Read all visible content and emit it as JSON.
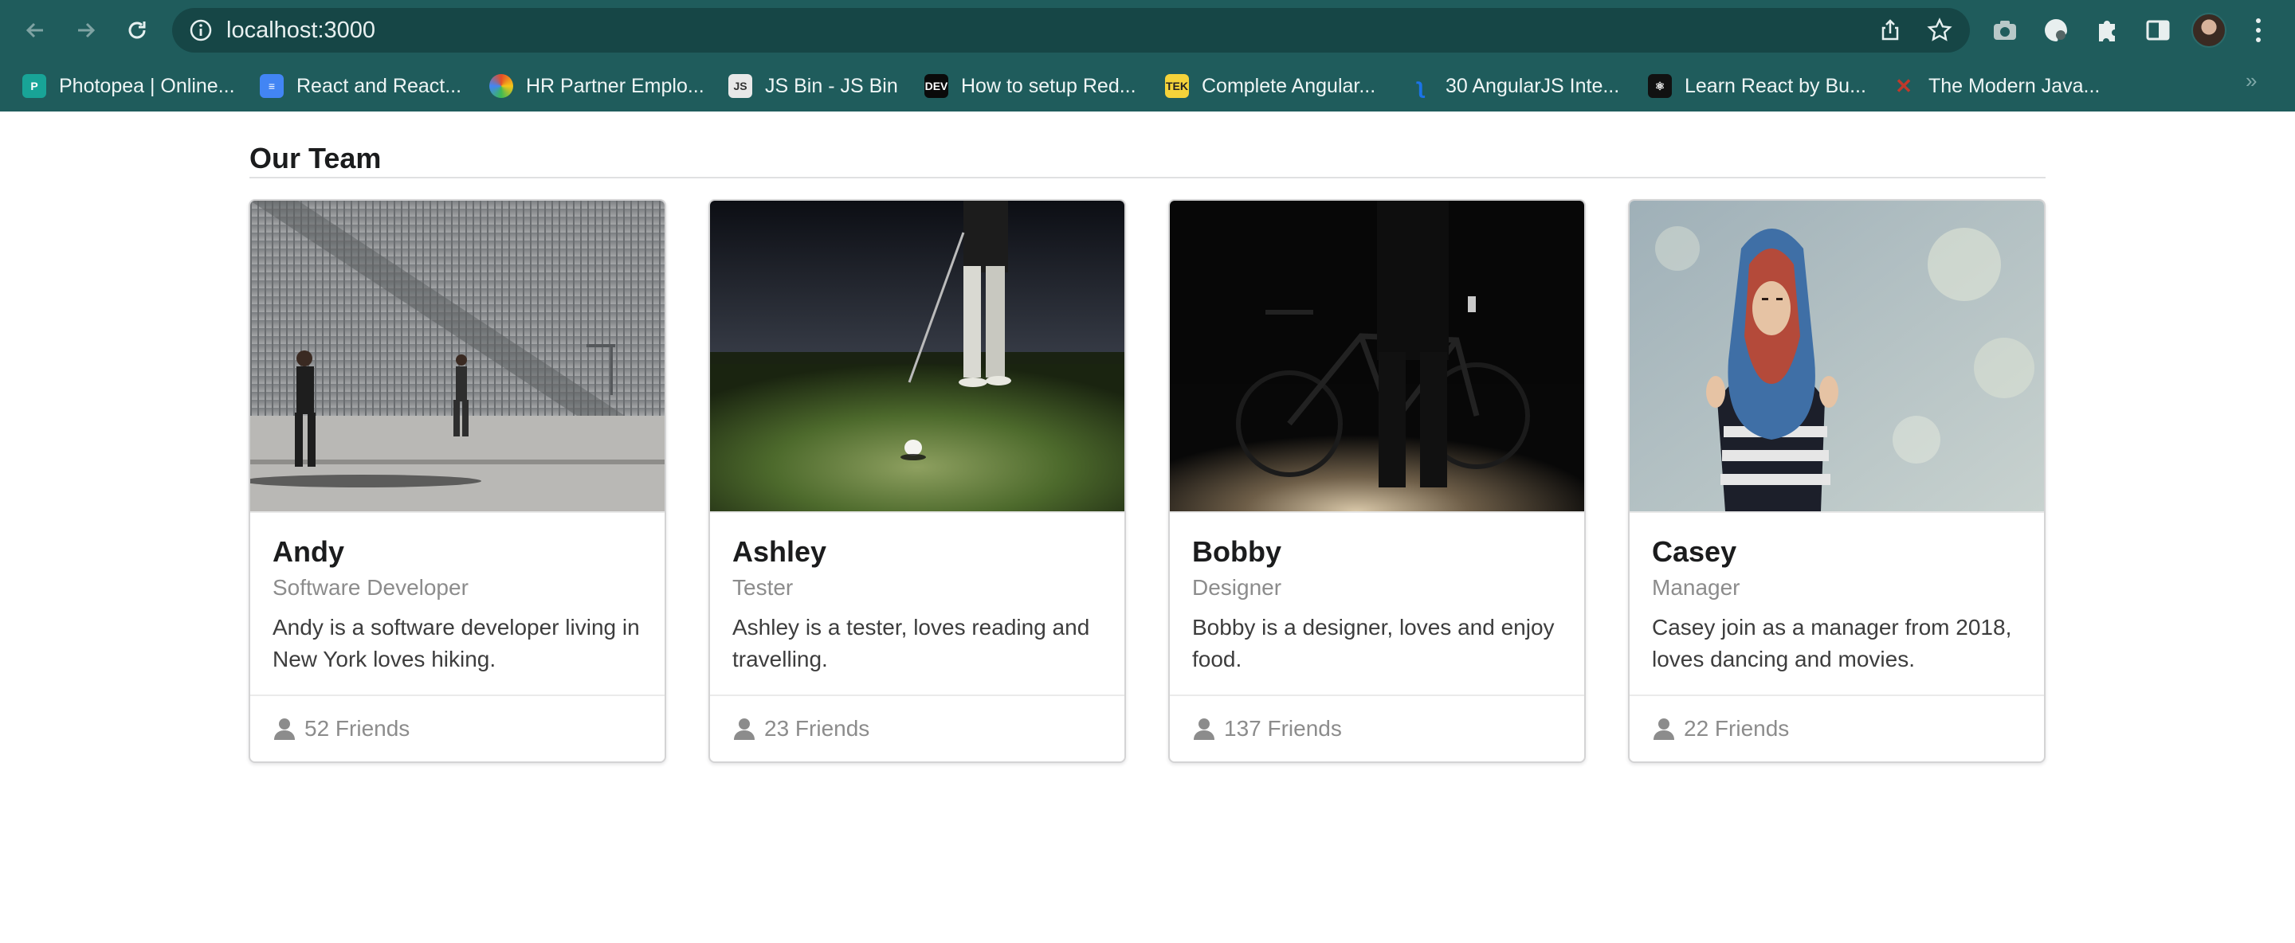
{
  "browser": {
    "url": "localhost:3000",
    "bookmarks": [
      {
        "label": "Photopea | Online...",
        "icon": "photopea-icon",
        "color": "#18a497"
      },
      {
        "label": "React and React...",
        "icon": "docs-icon",
        "color": "#4285f4"
      },
      {
        "label": "HR Partner Emplo...",
        "icon": "hr-partner-icon",
        "color": "#e44d26"
      },
      {
        "label": "JS Bin - JS Bin",
        "icon": "jsbin-icon",
        "color": "#e8e8e8"
      },
      {
        "label": "How to setup Red...",
        "icon": "dev-icon",
        "color": "#0a0a0a"
      },
      {
        "label": "Complete Angular...",
        "icon": "tek-icon",
        "color": "#f5d33a"
      },
      {
        "label": "30 AngularJS Inte...",
        "icon": "angular-icon",
        "color": "#1a73e8"
      },
      {
        "label": "Learn React by Bu...",
        "icon": "react-icon",
        "color": "#111111"
      },
      {
        "label": "The Modern Java...",
        "icon": "javascript-icon",
        "color": "#c0392b"
      }
    ]
  },
  "page": {
    "title": "Our Team",
    "members": [
      {
        "name": "Andy",
        "role": "Software Developer",
        "description": "Andy is a software developer living in New York loves hiking.",
        "friends": "52 Friends",
        "photo": "man-walking-by-wall-photo"
      },
      {
        "name": "Ashley",
        "role": "Tester",
        "description": "Ashley is a tester, loves reading and travelling.",
        "friends": "23 Friends",
        "photo": "golfer-putting-photo"
      },
      {
        "name": "Bobby",
        "role": "Designer",
        "description": "Bobby is a designer, loves and enjoy food.",
        "friends": "137 Friends",
        "photo": "person-with-bicycle-photo"
      },
      {
        "name": "Casey",
        "role": "Manager",
        "description": "Casey join as a manager from 2018, loves dancing and movies.",
        "friends": "22 Friends",
        "photo": "woman-with-scarf-photo"
      }
    ]
  }
}
